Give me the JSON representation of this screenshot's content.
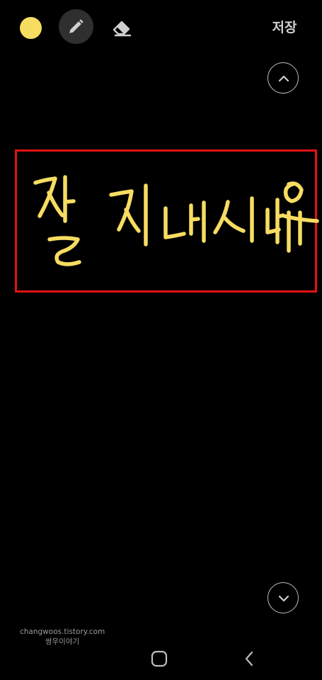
{
  "toolbar": {
    "pen_color": "#f6dc61",
    "save_label": "저장",
    "icons": {
      "color": "color-dot-icon",
      "pen": "pencil-icon",
      "eraser": "eraser-icon"
    }
  },
  "canvas": {
    "handwritten_text": "잘지내시나요",
    "highlight_color": "#e21212",
    "scroll_up_icon": "chevron-up-icon",
    "scroll_down_icon": "chevron-down-icon"
  },
  "watermark": {
    "line1": "changwoos.tistory.com",
    "line2": "쌍우이야기"
  },
  "navbar": {
    "home_icon": "home-square-icon",
    "back_icon": "back-chevron-icon"
  }
}
